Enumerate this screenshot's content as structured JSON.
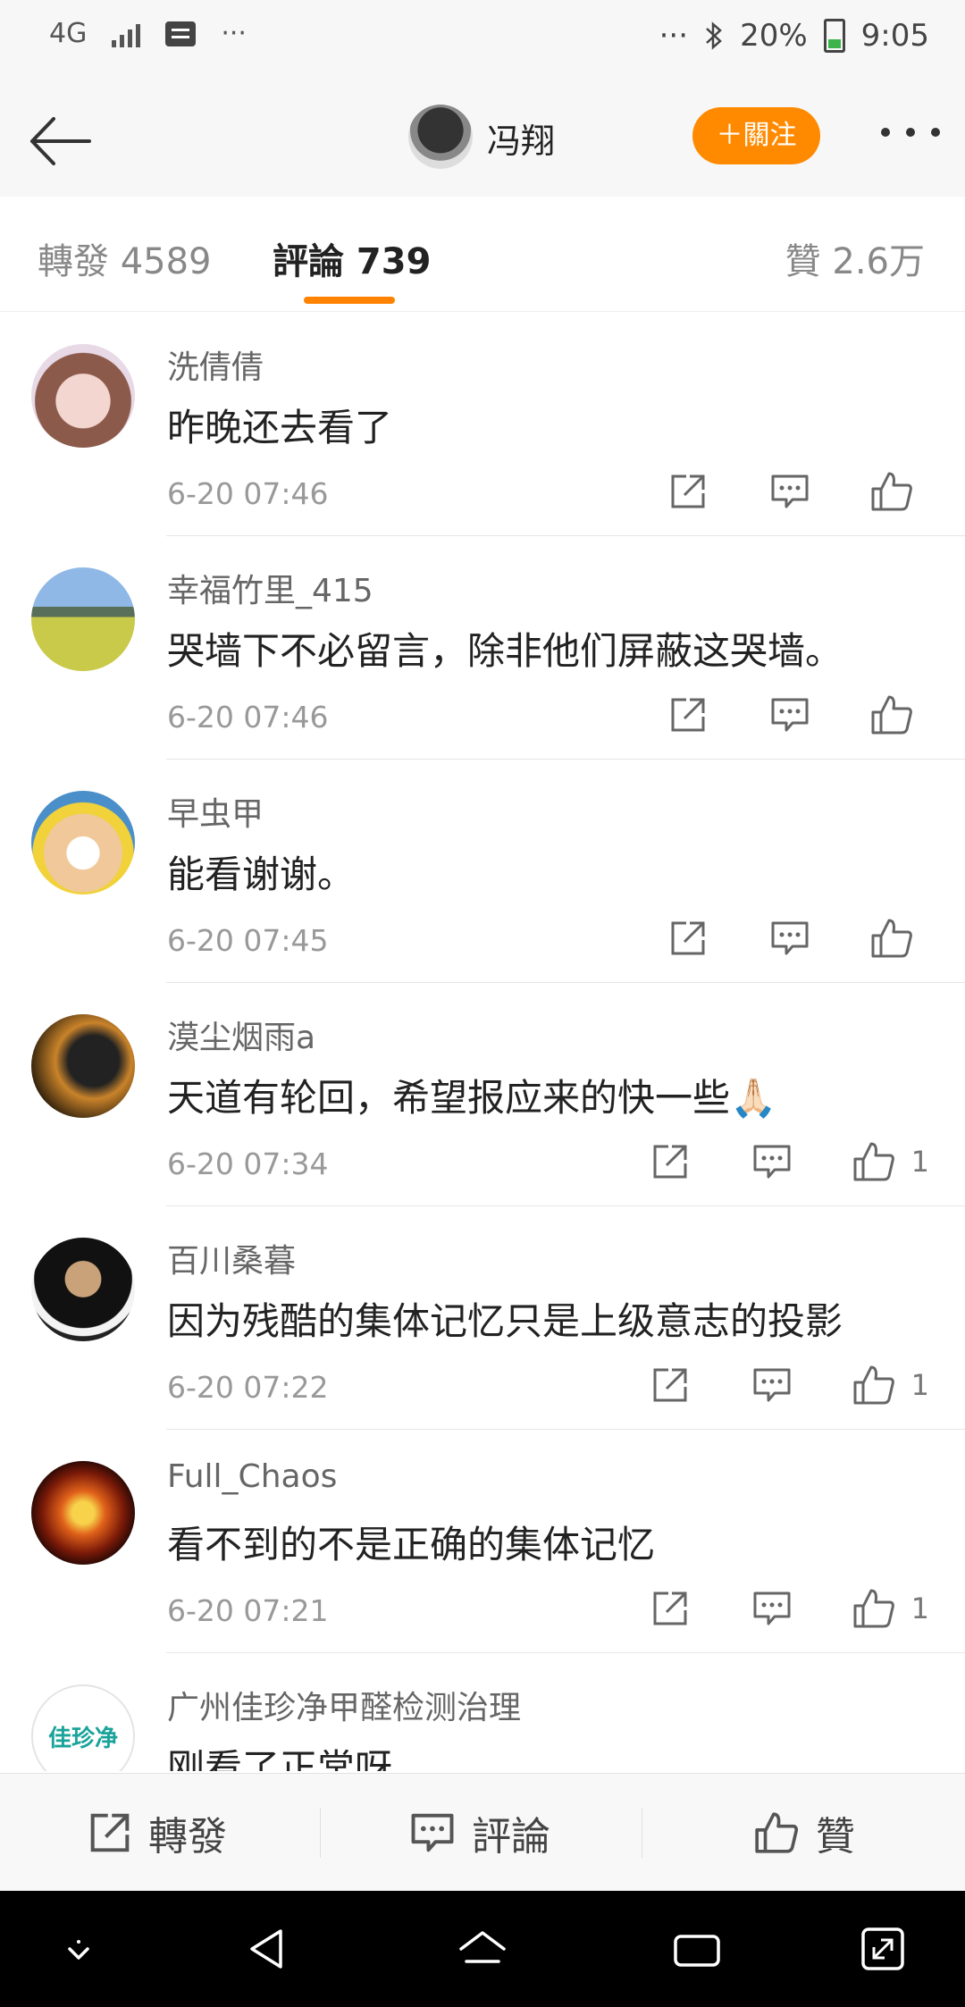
{
  "status_bar": {
    "network": "4G",
    "dots_left": "···",
    "dots_right": "···",
    "battery": "20%",
    "time": "9:05"
  },
  "header": {
    "user_name": "冯翔",
    "follow_label": "＋關注"
  },
  "tabs": [
    {
      "label": "轉發 4589",
      "active": false
    },
    {
      "label": "評論 739",
      "active": true
    },
    {
      "label": "贊 2.6万",
      "active": false
    }
  ],
  "comments": [
    {
      "name": "洗倩倩",
      "text": "昨晚还去看了",
      "time": "6-20 07:46",
      "likes": ""
    },
    {
      "name": "幸福竹里_415",
      "text": "哭墙下不必留言，除非他们屏蔽这哭墙。",
      "time": "6-20 07:46",
      "likes": ""
    },
    {
      "name": "早虫甲",
      "text": "能看谢谢。",
      "time": "6-20 07:45",
      "likes": ""
    },
    {
      "name": "漠尘烟雨a",
      "text": "天道有轮回，希望报应来的快一些🙏🏻",
      "time": "6-20 07:34",
      "likes": "1"
    },
    {
      "name": "百川桑暮",
      "text": "因为残酷的集体记忆只是上级意志的投影",
      "time": "6-20 07:22",
      "likes": "1"
    },
    {
      "name": "Full_Chaos",
      "text": "看不到的不是正确的集体记忆",
      "time": "6-20 07:21",
      "likes": "1"
    },
    {
      "name": "广州佳珍净甲醛检测治理",
      "text": "刚看了正常呀",
      "time": "",
      "likes": "",
      "avatar_text": "佳珍净"
    }
  ],
  "bottom_bar": {
    "repost": "轉發",
    "comment": "評論",
    "like": "贊"
  },
  "colors": {
    "accent": "#ff8200",
    "follow": "#ff8a00"
  }
}
